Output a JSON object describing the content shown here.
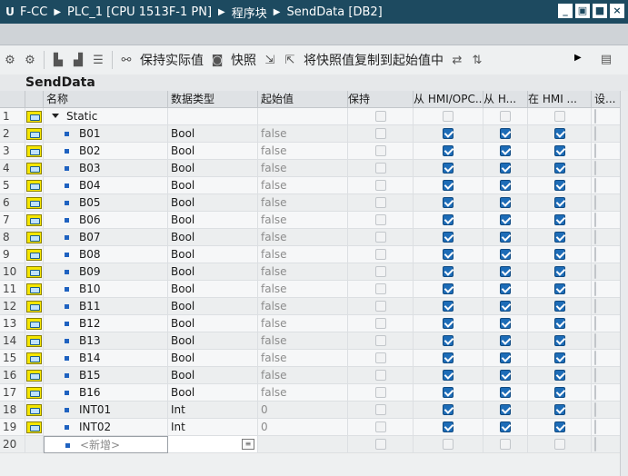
{
  "titlebar": {
    "crumbs": [
      "F-CC",
      "PLC_1 [CPU 1513F-1 PN]",
      "程序块",
      "SendData [DB2]"
    ]
  },
  "toolbar": {
    "keep_actual": "保持实际值",
    "snapshot": "快照",
    "copy_snapshot": "将快照值复制到起始值中"
  },
  "block_title": "SendData",
  "columns": {
    "name": "名称",
    "type": "数据类型",
    "start": "起始值",
    "keep": "保持",
    "hmi_opc": "从 HMI/OPC...",
    "hmi2": "从 H...",
    "hmi3": "在 HMI ...",
    "set": "设..."
  },
  "rows": [
    {
      "num": "1",
      "name": "Static",
      "type": "",
      "start": "",
      "kind": "group"
    },
    {
      "num": "2",
      "name": "B01",
      "type": "Bool",
      "start": "false"
    },
    {
      "num": "3",
      "name": "B02",
      "type": "Bool",
      "start": "false"
    },
    {
      "num": "4",
      "name": "B03",
      "type": "Bool",
      "start": "false"
    },
    {
      "num": "5",
      "name": "B04",
      "type": "Bool",
      "start": "false"
    },
    {
      "num": "6",
      "name": "B05",
      "type": "Bool",
      "start": "false"
    },
    {
      "num": "7",
      "name": "B06",
      "type": "Bool",
      "start": "false"
    },
    {
      "num": "8",
      "name": "B07",
      "type": "Bool",
      "start": "false"
    },
    {
      "num": "9",
      "name": "B08",
      "type": "Bool",
      "start": "false"
    },
    {
      "num": "10",
      "name": "B09",
      "type": "Bool",
      "start": "false"
    },
    {
      "num": "11",
      "name": "B10",
      "type": "Bool",
      "start": "false"
    },
    {
      "num": "12",
      "name": "B11",
      "type": "Bool",
      "start": "false"
    },
    {
      "num": "13",
      "name": "B12",
      "type": "Bool",
      "start": "false"
    },
    {
      "num": "14",
      "name": "B13",
      "type": "Bool",
      "start": "false"
    },
    {
      "num": "15",
      "name": "B14",
      "type": "Bool",
      "start": "false"
    },
    {
      "num": "16",
      "name": "B15",
      "type": "Bool",
      "start": "false"
    },
    {
      "num": "17",
      "name": "B16",
      "type": "Bool",
      "start": "false"
    },
    {
      "num": "18",
      "name": "INT01",
      "type": "Int",
      "start": "0"
    },
    {
      "num": "19",
      "name": "INT02",
      "type": "Int",
      "start": "0"
    }
  ],
  "new_row": {
    "num": "20",
    "placeholder": "<新增>"
  }
}
